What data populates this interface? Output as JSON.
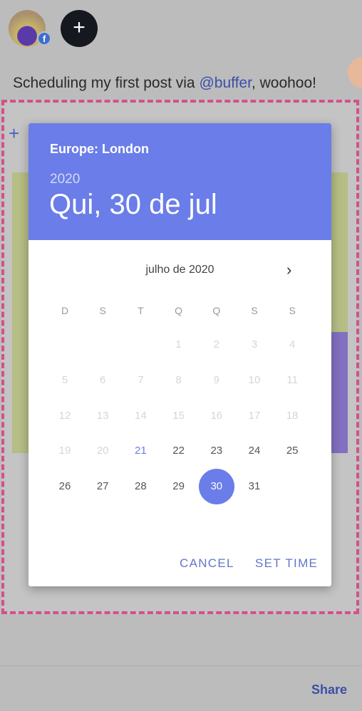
{
  "composer": {
    "avatar_badge": "facebook-icon",
    "add_account_icon": "plus-icon",
    "text_before": "Scheduling my first post via ",
    "mention": "@buffer",
    "text_after": ", woohoo!"
  },
  "media": {
    "add_icon": "plus-icon"
  },
  "datepicker": {
    "timezone": "Europe: London",
    "year": "2020",
    "date_label": "Qui, 30 de jul",
    "month_label": "julho de 2020",
    "next_icon": "chevron-right-icon",
    "weekdays": [
      "D",
      "S",
      "T",
      "Q",
      "Q",
      "S",
      "S"
    ],
    "weeks": [
      [
        null,
        null,
        null,
        1,
        2,
        3,
        4
      ],
      [
        5,
        6,
        7,
        8,
        9,
        10,
        11
      ],
      [
        12,
        13,
        14,
        15,
        16,
        17,
        18
      ],
      [
        19,
        20,
        21,
        22,
        23,
        24,
        25
      ],
      [
        26,
        27,
        28,
        29,
        30,
        31,
        null
      ]
    ],
    "today": 21,
    "selected": 30,
    "first_enabled": 21,
    "cancel_label": "CANCEL",
    "set_time_label": "SET TIME",
    "accent_color": "#6a7de8"
  },
  "footer": {
    "share_label": "Share"
  }
}
